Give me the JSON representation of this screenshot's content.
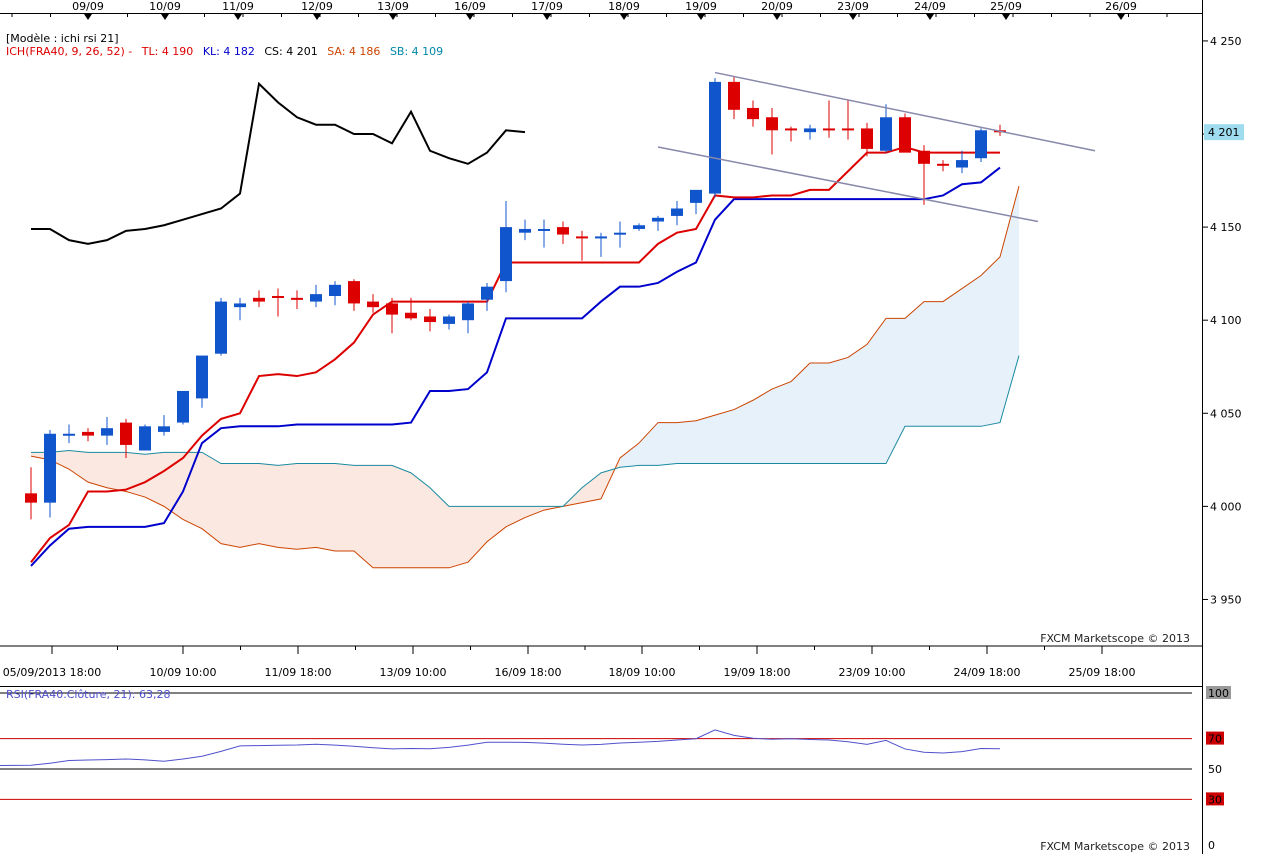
{
  "chart_data": {
    "type": "candlestick",
    "template_label": "[Modèle : ichi rsi 21]",
    "indicator_label": "ICH(FRA40, 9, 26, 52) -",
    "indicator_values": [
      {
        "label": "TL: 4 190",
        "color": "#dd0000"
      },
      {
        "label": "KL: 4 182",
        "color": "#0000cc"
      },
      {
        "label": "CS: 4 201",
        "color": "#000000"
      },
      {
        "label": "SA: 4 186",
        "color": "#cc4400"
      },
      {
        "label": "SB: 4 109",
        "color": "#0088aa"
      }
    ],
    "top_dates": [
      "09/09",
      "10/09",
      "11/09",
      "12/09",
      "13/09",
      "16/09",
      "17/09",
      "18/09",
      "19/09",
      "20/09",
      "23/09",
      "24/09",
      "25/09",
      "26/09"
    ],
    "bottom_dates": [
      "05/09/2013 18:00",
      "10/09 10:00",
      "11/09 18:00",
      "13/09 10:00",
      "16/09 18:00",
      "18/09 10:00",
      "19/09 18:00",
      "23/09 10:00",
      "24/09 18:00",
      "25/09 18:00"
    ],
    "y_ticks": [
      "4 250",
      "4 200",
      "4 150",
      "4 100",
      "4 050",
      "4 000",
      "3 950"
    ],
    "current_price_label": "4 201",
    "current_price": 4201,
    "ylim": [
      3925,
      4265
    ],
    "watermark": "FXCM Marketscope © 2013",
    "candles": [
      [
        4007,
        4021,
        3993,
        4002
      ],
      [
        4002,
        4041,
        3994,
        4039
      ],
      [
        4039,
        4044,
        4034,
        4039
      ],
      [
        4040,
        4042,
        4035,
        4038
      ],
      [
        4038,
        4048,
        4033,
        4042
      ],
      [
        4045,
        4047,
        4026,
        4033
      ],
      [
        4030,
        4044,
        4030,
        4043
      ],
      [
        4040,
        4049,
        4038,
        4043
      ],
      [
        4045,
        4052,
        4044,
        4062
      ],
      [
        4058,
        4073,
        4053,
        4081
      ],
      [
        4082,
        4112,
        4081,
        4110
      ],
      [
        4107,
        4112,
        4100,
        4109
      ],
      [
        4112,
        4116,
        4107,
        4110
      ],
      [
        4113,
        4117,
        4102,
        4112
      ],
      [
        4112,
        4116,
        4106,
        4111
      ],
      [
        4110,
        4119,
        4107,
        4114
      ],
      [
        4113,
        4121,
        4108,
        4119
      ],
      [
        4121,
        4122,
        4105,
        4109
      ],
      [
        4110,
        4114,
        4104,
        4107
      ],
      [
        4109,
        4112,
        4093,
        4103
      ],
      [
        4104,
        4112,
        4100,
        4101
      ],
      [
        4102,
        4106,
        4094,
        4099
      ],
      [
        4098,
        4103,
        4095,
        4102
      ],
      [
        4100,
        4110,
        4093,
        4109
      ],
      [
        4111,
        4120,
        4105,
        4118
      ],
      [
        4121,
        4164,
        4115,
        4150
      ],
      [
        4147,
        4154,
        4143,
        4149
      ],
      [
        4149,
        4154,
        4139,
        4149
      ],
      [
        4150,
        4153,
        4141,
        4146
      ],
      [
        4145,
        4148,
        4132,
        4144
      ],
      [
        4144,
        4147,
        4134,
        4145
      ],
      [
        4147,
        4153,
        4139,
        4147
      ],
      [
        4149,
        4152,
        4148,
        4151
      ],
      [
        4153,
        4156,
        4148,
        4155
      ],
      [
        4156,
        4164,
        4151,
        4160
      ],
      [
        4163,
        4168,
        4157,
        4170
      ],
      [
        4168,
        4230,
        4166,
        4228
      ],
      [
        4228,
        4231,
        4208,
        4213
      ],
      [
        4214,
        4218,
        4204,
        4208
      ],
      [
        4209,
        4214,
        4189,
        4202
      ],
      [
        4203,
        4204,
        4196,
        4202
      ],
      [
        4201,
        4205,
        4197,
        4203
      ],
      [
        4203,
        4218,
        4198,
        4202
      ],
      [
        4203,
        4218,
        4197,
        4202
      ],
      [
        4203,
        4206,
        4188,
        4192
      ],
      [
        4191,
        4216,
        4190,
        4209
      ],
      [
        4209,
        4211,
        4192,
        4190
      ],
      [
        4191,
        4194,
        4162,
        4184
      ],
      [
        4184,
        4186,
        4180,
        4183
      ],
      [
        4182,
        4191,
        4179,
        4186
      ],
      [
        4187,
        4203,
        4185,
        4202
      ],
      [
        4202,
        4205,
        4199,
        4201
      ]
    ],
    "tenkan": [
      3970,
      3983,
      3990,
      4008,
      4008,
      4009,
      4013,
      4019,
      4026,
      4038,
      4047,
      4050,
      4070,
      4071,
      4070,
      4072,
      4079,
      4088,
      4103,
      4110,
      4110,
      4110,
      4110,
      4110,
      4110,
      4131,
      4131,
      4131,
      4131,
      4131,
      4131,
      4131,
      4131,
      4141,
      4147,
      4149,
      4167,
      4166,
      4166,
      4167,
      4167,
      4170,
      4170,
      4180,
      4190,
      4190,
      4193,
      4190,
      4190,
      4190,
      4190,
      4190
    ],
    "kijun": [
      3968,
      3979,
      3988,
      3989,
      3989,
      3989,
      3989,
      3991,
      4008,
      4034,
      4042,
      4043,
      4043,
      4043,
      4044,
      4044,
      4044,
      4044,
      4044,
      4044,
      4045,
      4062,
      4062,
      4063,
      4072,
      4101,
      4101,
      4101,
      4101,
      4101,
      4110,
      4118,
      4118,
      4120,
      4126,
      4131,
      4154,
      4165,
      4165,
      4165,
      4165,
      4165,
      4165,
      4165,
      4165,
      4165,
      4165,
      4165,
      4167,
      4173,
      4174,
      4182
    ],
    "chikou": [
      4149,
      4149,
      4143,
      4141,
      4143,
      4148,
      4149,
      4151,
      4154,
      4157,
      4160,
      4168,
      4227,
      4217,
      4209,
      4205,
      4205,
      4200,
      4200,
      4195,
      4212,
      4191,
      4187,
      4184,
      4190,
      4202,
      4201
    ],
    "senkou_a": [
      4027,
      4025,
      4020,
      4013,
      4010,
      4008,
      4005,
      4000,
      3993,
      3988,
      3980,
      3978,
      3980,
      3978,
      3977,
      3978,
      3976,
      3976,
      3967,
      3967,
      3967,
      3967,
      3967,
      3970,
      3981,
      3989,
      3994,
      3998,
      4000,
      4002,
      4004,
      4026,
      4034,
      4045,
      4045,
      4046,
      4049,
      4052,
      4057,
      4063,
      4067,
      4077,
      4077,
      4080,
      4087,
      4101,
      4101,
      4110,
      4110,
      4117,
      4124,
      4134,
      4172
    ],
    "senkou_b": [
      4029,
      4029,
      4030,
      4029,
      4029,
      4029,
      4028,
      4029,
      4029,
      4029,
      4023,
      4023,
      4023,
      4022,
      4023,
      4023,
      4023,
      4022,
      4022,
      4022,
      4018,
      4010,
      4000,
      4000,
      4000,
      4000,
      4000,
      4000,
      4000,
      4010,
      4018,
      4021,
      4022,
      4022,
      4023,
      4023,
      4023,
      4023,
      4023,
      4023,
      4023,
      4023,
      4023,
      4023,
      4023,
      4023,
      4043,
      4043,
      4043,
      4043,
      4043,
      4045,
      4081
    ],
    "trend_lines": [
      {
        "from": [
          36,
          4233
        ],
        "to": [
          56,
          4191
        ]
      },
      {
        "from": [
          33,
          4193
        ],
        "to": [
          53,
          4153
        ]
      }
    ],
    "rsi": {
      "label": "RSI(FRA40.Clôture, 21): 63,28",
      "levels": [
        {
          "value": 100,
          "label": "100",
          "label_bg": "#999999",
          "label_fg": "#000000",
          "line": "#000000"
        },
        {
          "value": 70,
          "label": "70",
          "label_bg": "#cc0000",
          "label_fg": "#000000",
          "line": "#cc0000"
        },
        {
          "value": 50,
          "label": "50",
          "label_bg": "#ffffff",
          "label_fg": "#000000",
          "line": "#000000"
        },
        {
          "value": 30,
          "label": "30",
          "label_bg": "#cc0000",
          "label_fg": "#000000",
          "line": "#cc0000"
        },
        {
          "value": 0,
          "label": "0",
          "label_bg": "#ffffff",
          "label_fg": "#000000",
          "line": "#000000"
        }
      ],
      "values": [
        52.5,
        53.8,
        55.6,
        55.9,
        56.2,
        56.6,
        56.0,
        55.1,
        56.6,
        58.4,
        61.6,
        65.2,
        65.4,
        65.6,
        65.8,
        66.3,
        65.7,
        65.0,
        64.0,
        63.2,
        63.5,
        63.3,
        64.2,
        65.7,
        67.6,
        67.6,
        67.5,
        67.0,
        66.3,
        65.8,
        66.2,
        67.1,
        67.6,
        68.2,
        69.1,
        69.9,
        75.7,
        72.1,
        70.2,
        69.6,
        69.9,
        69.4,
        69.1,
        67.9,
        66.2,
        68.8,
        63.2,
        61.0,
        60.5,
        61.4,
        63.5,
        63.3
      ],
      "watermark": "FXCM Marketscope © 2013"
    },
    "colors": {
      "up_candle": "#1155cc",
      "down_candle": "#dd0000",
      "tenkan": "#dd0000",
      "kijun": "#0000cc",
      "chikou": "#000000",
      "senkou_a": "#cc4400",
      "senkou_b": "#1a8aa0",
      "cloud_bull": "#e6f1fa",
      "cloud_bear": "#fbe9e1",
      "trendline": "#8888aa",
      "rsi_line": "#5050cc",
      "price_tag": "#9fdcf0"
    }
  }
}
